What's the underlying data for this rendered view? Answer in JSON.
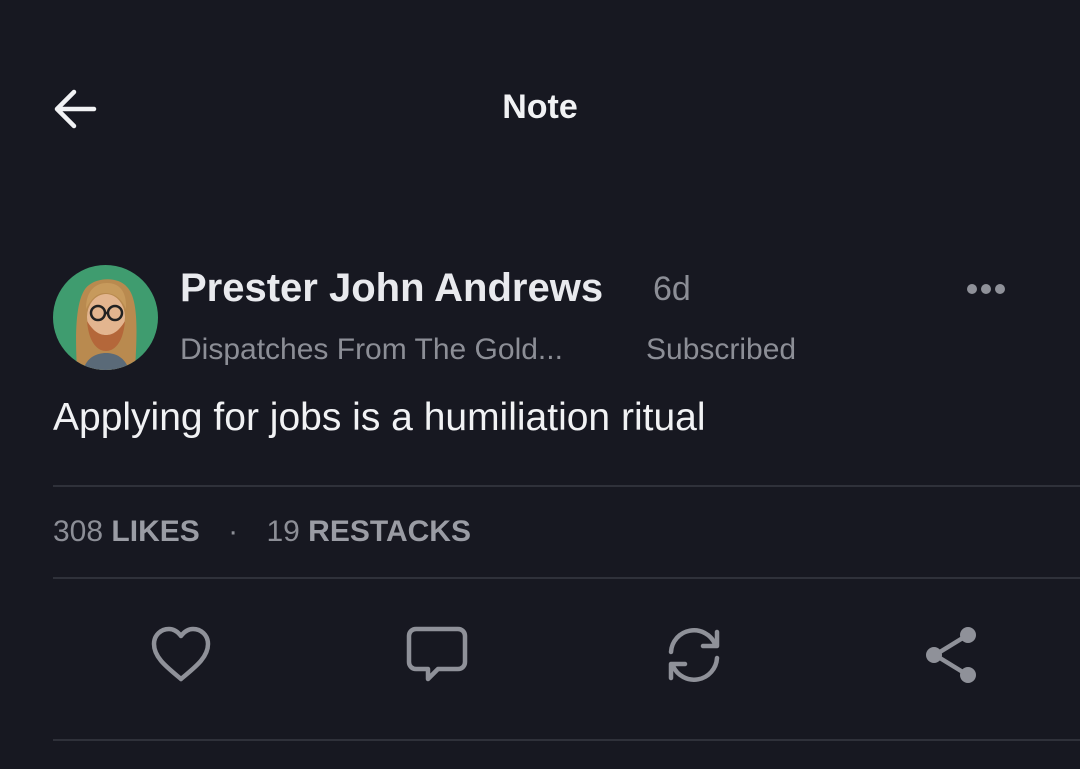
{
  "header": {
    "title": "Note",
    "back_icon": "arrow-left-icon"
  },
  "post": {
    "author": "Prester John Andrews",
    "age": "6d",
    "publication": "Dispatches From The Gold...",
    "subscription_status": "Subscribed",
    "text": "Applying for jobs is a humiliation ritual",
    "more_icon": "more-horizontal-icon"
  },
  "stats": {
    "likes_count": "308",
    "likes_label": "LIKES",
    "separator": "·",
    "restacks_count": "19",
    "restacks_label": "RESTACKS"
  },
  "actions": {
    "like_icon": "heart-icon",
    "comment_icon": "comment-icon",
    "restack_icon": "restack-icon",
    "share_icon": "share-icon"
  },
  "colors": {
    "background": "#171821",
    "primary_text": "#f1f2f4",
    "secondary_text": "#8c8e96",
    "divider": "#2f313a",
    "icon": "#8f9199"
  }
}
